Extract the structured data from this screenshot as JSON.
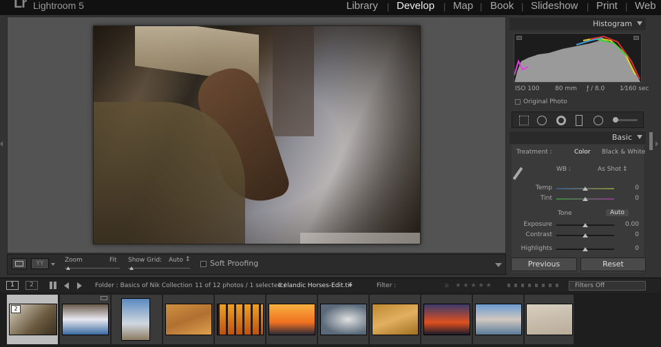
{
  "app": {
    "logo": "Lr",
    "name": "Lightroom 5"
  },
  "modules": [
    {
      "label": "Library",
      "active": false
    },
    {
      "label": "Develop",
      "active": true
    },
    {
      "label": "Map",
      "active": false
    },
    {
      "label": "Book",
      "active": false
    },
    {
      "label": "Slideshow",
      "active": false
    },
    {
      "label": "Print",
      "active": false
    },
    {
      "label": "Web",
      "active": false
    }
  ],
  "toolbar": {
    "zoom_label": "Zoom",
    "zoom_value": "Fit",
    "grid_label": "Show Grid:",
    "grid_value": "Auto",
    "grid_arrow": "↕",
    "soft_proofing": "Soft Proofing",
    "soft_proofing_checked": false,
    "yy_label": "YY"
  },
  "histogram": {
    "title": "Histogram",
    "iso": "ISO 100",
    "focal": "80 mm",
    "aperture": "ƒ / 8.0",
    "shutter": "1⁄160 sec",
    "original_photo": "Original Photo"
  },
  "basic": {
    "title": "Basic",
    "treatment_label": "Treatment :",
    "treatment_color": "Color",
    "treatment_bw": "Black & White",
    "wb_label": "WB :",
    "wb_value": "As Shot",
    "wb_arrow": "↕",
    "tone_label": "Tone",
    "auto_label": "Auto",
    "sliders": [
      {
        "label": "Temp",
        "value": "0",
        "pos": 0.5
      },
      {
        "label": "Tint",
        "value": "0",
        "pos": 0.5
      },
      {
        "label": "Exposure",
        "value": "0.00",
        "pos": 0.5
      },
      {
        "label": "Contrast",
        "value": "0",
        "pos": 0.5
      },
      {
        "label": "Highlights",
        "value": "0",
        "pos": 0.5
      }
    ]
  },
  "buttons": {
    "previous": "Previous",
    "reset": "Reset"
  },
  "filmstrip": {
    "screen1": "1",
    "screen2": "2",
    "folder": "Folder : Basics of Nik Collection",
    "count": "11 of 12 photos / 1 selected /",
    "filename": "Icelandic Horses-Edit.tif",
    "filter_label": "Filter :",
    "filters_off": "Filters Off",
    "selected_badge": "2",
    "thumbs": [
      "horses",
      "waves",
      "pelican",
      "sand",
      "pier-sunset",
      "sunset",
      "surf",
      "dunes",
      "dusk",
      "town",
      "beach-grass"
    ]
  },
  "colors": {
    "accent": "#eeeeee",
    "panel": "#333333",
    "dark": "#1e1e1e"
  }
}
